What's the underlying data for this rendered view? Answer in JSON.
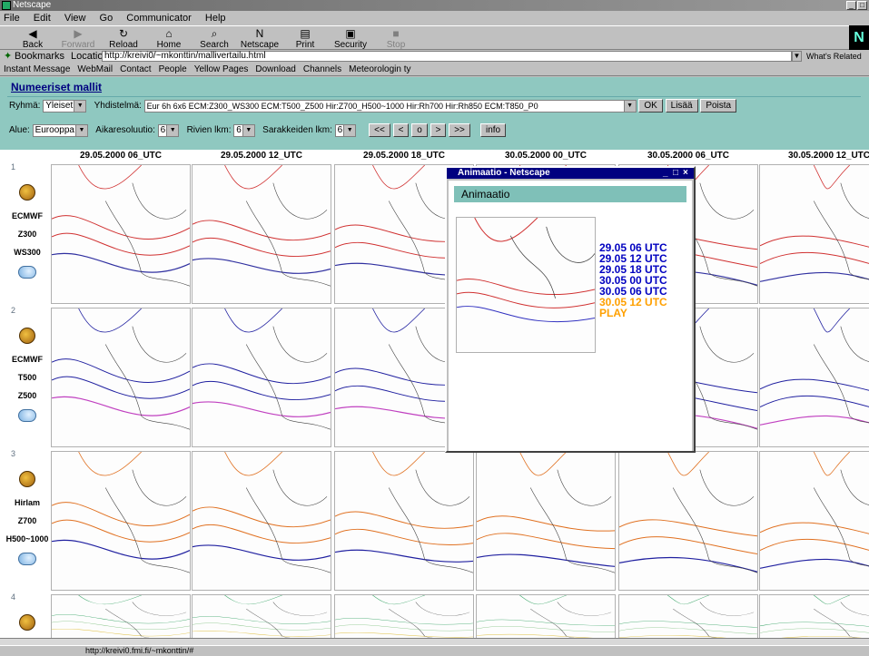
{
  "window": {
    "title": "Netscape"
  },
  "menu": [
    "File",
    "Edit",
    "View",
    "Go",
    "Communicator",
    "Help"
  ],
  "toolbar": [
    {
      "label": "Back",
      "icon": "back-arrow-icon",
      "enabled": true
    },
    {
      "label": "Forward",
      "icon": "forward-arrow-icon",
      "enabled": false
    },
    {
      "label": "Reload",
      "icon": "reload-icon",
      "enabled": true
    },
    {
      "label": "Home",
      "icon": "home-icon",
      "enabled": true
    },
    {
      "label": "Search",
      "icon": "search-icon",
      "enabled": true
    },
    {
      "label": "Netscape",
      "icon": "netscape-icon",
      "enabled": true
    },
    {
      "label": "Print",
      "icon": "print-icon",
      "enabled": true
    },
    {
      "label": "Security",
      "icon": "lock-icon",
      "enabled": true
    },
    {
      "label": "Stop",
      "icon": "stop-icon",
      "enabled": false
    }
  ],
  "location": {
    "bookmarks": "Bookmarks",
    "label": "Location:",
    "url": "http://kreivi0/~mkonttin/mallivertailu.html",
    "related": "What's Related"
  },
  "personal": [
    "Instant Message",
    "WebMail",
    "Contact",
    "People",
    "Yellow Pages",
    "Download",
    "Channels",
    "Meteorologin ty"
  ],
  "page": {
    "title": "Numeeriset mallit",
    "group_label": "Ryhmä:",
    "group_value": "Yleiset",
    "combo_label": "Yhdistelmä:",
    "combo_value": "Eur 6h 6x6 ECM:Z300_WS300 ECM:T500_Z500 Hir:Z700_H500~1000 Hir:Rh700 Hir:Rh850 ECM:T850_P0",
    "ok": "OK",
    "add": "Lisää",
    "remove": "Poista",
    "area_label": "Alue:",
    "area_value": "Eurooppa",
    "step_label": "Aikaresoluutio:",
    "step_value": "6",
    "rows_label": "Rivien lkm:",
    "rows_value": "6",
    "cols_label": "Sarakkeiden lkm:",
    "cols_value": "6",
    "nav": [
      "<<",
      "<",
      "o",
      ">",
      ">>"
    ],
    "info": "info"
  },
  "columns": [
    "29.05.2000 06_UTC",
    "29.05.2000 12_UTC",
    "29.05.2000 18_UTC",
    "30.05.2000 00_UTC",
    "30.05.2000 06_UTC",
    "30.05.2000 12_UTC"
  ],
  "rows": [
    {
      "num": "1",
      "model": "ECMWF",
      "l1": "Z300",
      "l2": "WS300",
      "style": "red"
    },
    {
      "num": "2",
      "model": "ECMWF",
      "l1": "T500",
      "l2": "Z500",
      "style": "blue"
    },
    {
      "num": "3",
      "model": "Hirlam",
      "l1": "Z700",
      "l2": "H500~1000",
      "style": "orange"
    },
    {
      "num": "4",
      "model": "",
      "l1": "",
      "l2": "",
      "style": "green"
    }
  ],
  "popup": {
    "title": "Animaatio - Netscape",
    "heading": "Animaatio",
    "frames": [
      {
        "label": "29.05 06 UTC",
        "color": "#0000c0"
      },
      {
        "label": "29.05 12 UTC",
        "color": "#0000c0"
      },
      {
        "label": "29.05 18 UTC",
        "color": "#0000c0"
      },
      {
        "label": "30.05 00 UTC",
        "color": "#0000c0"
      },
      {
        "label": "30.05 06 UTC",
        "color": "#0000c0"
      },
      {
        "label": "30.05 12 UTC",
        "color": "#ffa000"
      },
      {
        "label": "PLAY",
        "color": "#ffa000"
      }
    ]
  },
  "status": {
    "text": "http://kreivi0.fmi.fi/~mkonttin/#"
  }
}
